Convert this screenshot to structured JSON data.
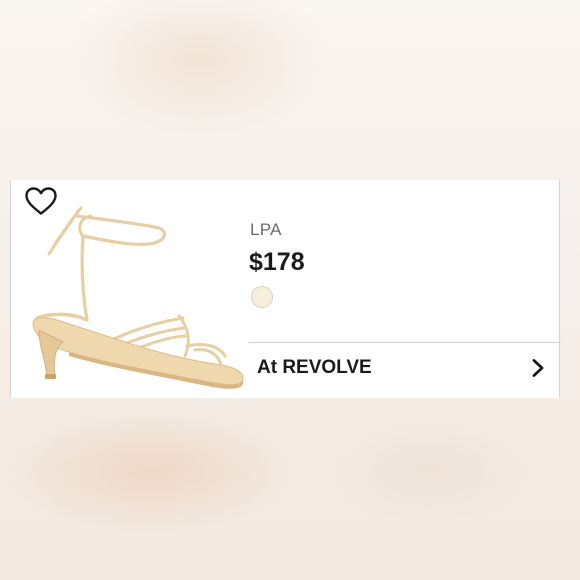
{
  "product": {
    "brand": "LPA",
    "price": "$178",
    "image_alt": "Lace-up strappy kitten heel sandal in nude",
    "swatch_color": "#f5efdc"
  },
  "retailer_link": {
    "label": "At REVOLVE"
  },
  "icons": {
    "favorite": "heart-outline-icon",
    "navigate": "chevron-right-icon"
  }
}
